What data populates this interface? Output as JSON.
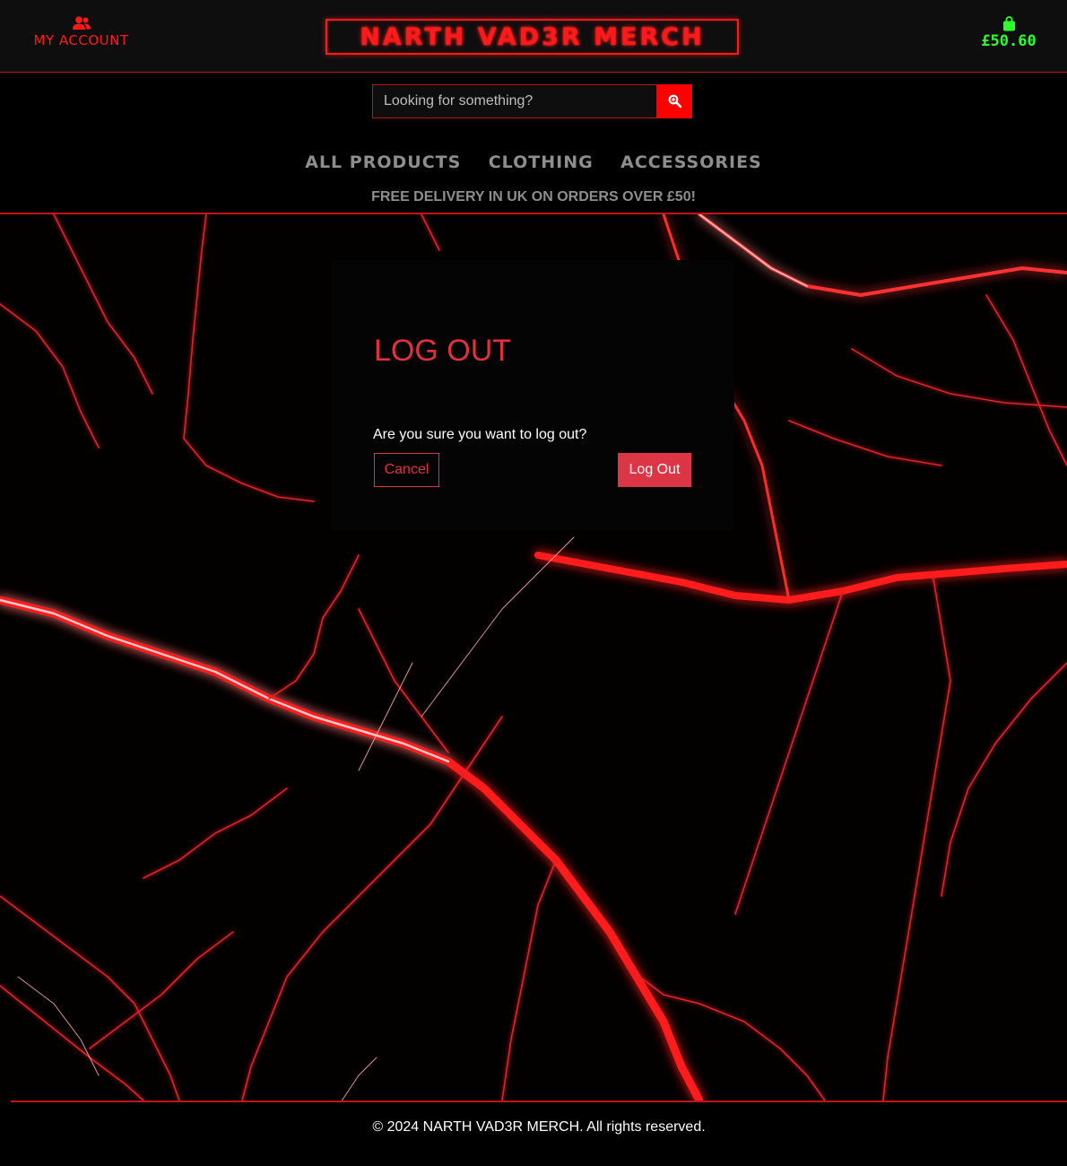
{
  "header": {
    "account_label": "MY ACCOUNT",
    "brand": "NARTH VAD3R MERCH",
    "bag_total": "£50.60",
    "colors": {
      "accent": "#ff1a1a",
      "bag": "#2bff2b"
    }
  },
  "search": {
    "placeholder": "Looking for something?"
  },
  "nav": {
    "links": [
      "ALL PRODUCTS",
      "CLOTHING",
      "ACCESSORIES"
    ]
  },
  "banner": {
    "delivery": "FREE DELIVERY IN UK ON ORDERS OVER £50!"
  },
  "logout": {
    "title": "LOG OUT",
    "message": "Are you sure you want to log out?",
    "cancel_label": "Cancel",
    "logout_label": "Log Out"
  },
  "footer": {
    "copyright": "© 2024 NARTH VAD3R MERCH. All rights reserved."
  },
  "icons": {
    "account": "users-icon",
    "bag": "shopping-bag-icon",
    "search": "search-icon"
  }
}
